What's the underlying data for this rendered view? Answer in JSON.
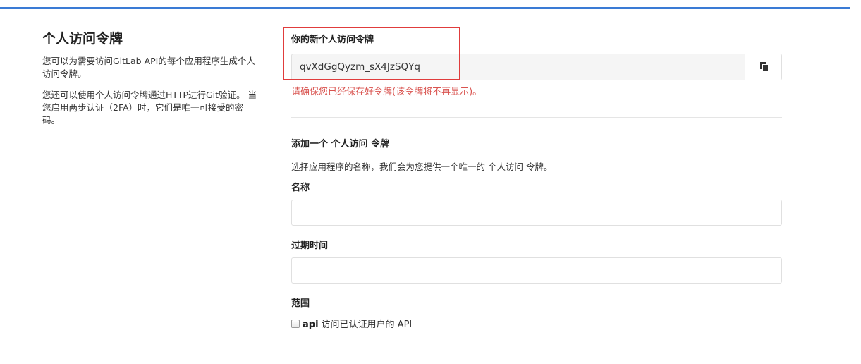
{
  "left": {
    "title": "个人访问令牌",
    "desc1": "您可以为需要访问GitLab API的每个应用程序生成个人访问令牌。",
    "desc2": "您还可以使用个人访问令牌通过HTTP进行Git验证。 当您启用两步认证（2FA）时，它们是唯一可接受的密码。"
  },
  "new_token": {
    "label": "你的新个人访问令牌",
    "value": "qvXdGgQyzm_sX4JzSQYq",
    "copy_icon": "clipboard-icon",
    "warning": "请确保您已经保存好令牌(该令牌将不再显示)。"
  },
  "add_form": {
    "title": "添加一个 个人访问 令牌",
    "desc": "选择应用程序的名称，我们会为您提供一个唯一的 个人访问 令牌。",
    "name_label": "名称",
    "name_value": "",
    "expires_label": "过期时间",
    "expires_value": "",
    "scopes_label": "范围",
    "scopes": [
      {
        "name": "api",
        "desc": "访问已认证用户的 API"
      }
    ]
  },
  "colors": {
    "accent_border": "#3a7bd5",
    "highlight": "#e03c3c",
    "warning_text": "#d9534f"
  }
}
